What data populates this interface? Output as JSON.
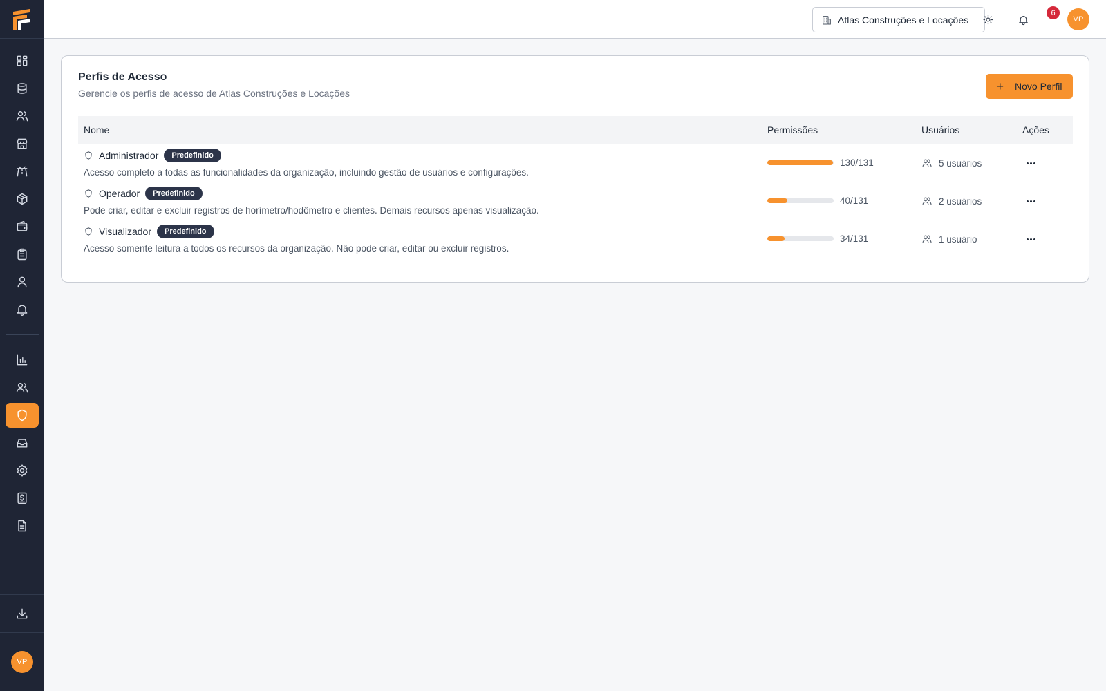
{
  "sidebar": {
    "nav_top": [
      {
        "icon": "dashboard-icon"
      },
      {
        "icon": "database-icon"
      },
      {
        "icon": "users-icon"
      },
      {
        "icon": "store-icon"
      },
      {
        "icon": "road-icon"
      },
      {
        "icon": "package-icon"
      },
      {
        "icon": "wallet-icon"
      },
      {
        "icon": "clipboard-icon"
      },
      {
        "icon": "user-icon"
      },
      {
        "icon": "bell-icon"
      }
    ],
    "nav_bottom": [
      {
        "icon": "chart-icon"
      },
      {
        "icon": "users-icon"
      },
      {
        "icon": "shield-icon",
        "active": true
      },
      {
        "icon": "inbox-icon"
      },
      {
        "icon": "gear-icon"
      },
      {
        "icon": "dollar-receipt-icon"
      },
      {
        "icon": "document-icon"
      }
    ],
    "user_initials": "VP"
  },
  "topbar": {
    "organization": "Atlas Construções e Locações",
    "notification_count": "6",
    "user_initials": "VP"
  },
  "page": {
    "title": "Perfis de Acesso",
    "subtitle": "Gerencie os perfis de acesso de Atlas Construções e Locações",
    "new_button_label": "Novo Perfil",
    "columns": {
      "name": "Nome",
      "permissions": "Permissões",
      "users": "Usuários",
      "actions": "Ações"
    },
    "profiles": [
      {
        "name": "Administrador",
        "badge": "Predefinido",
        "description": "Acesso completo a todas as funcionalidades da organização, incluindo gestão de usuários e configurações.",
        "permissions": "130/131",
        "permissions_fraction": 0.992,
        "users": "5 usuários"
      },
      {
        "name": "Operador",
        "badge": "Predefinido",
        "description": "Pode criar, editar e excluir registros de horímetro/hodômetro e clientes. Demais recursos apenas visualização.",
        "permissions": "40/131",
        "permissions_fraction": 0.305,
        "users": "2 usuários"
      },
      {
        "name": "Visualizador",
        "badge": "Predefinido",
        "description": "Acesso somente leitura a todos os recursos da organização. Não pode criar, editar ou excluir registros.",
        "permissions": "34/131",
        "permissions_fraction": 0.26,
        "users": "1 usuário"
      }
    ]
  },
  "colors": {
    "accent": "#f7922e",
    "sidebar": "#1f2535",
    "badge": "#2c3449",
    "notification": "#d5283a"
  }
}
